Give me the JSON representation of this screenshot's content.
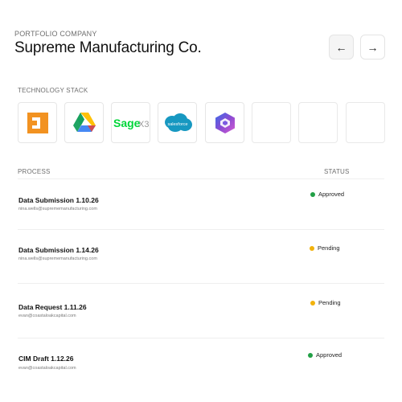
{
  "header": {
    "eyebrow": "PORTFOLIO COMPANY",
    "title": "Supreme Manufacturing Co.",
    "prev_icon": "arrow-left-icon",
    "next_icon": "arrow-right-icon",
    "prev_glyph": "←",
    "next_glyph": "→"
  },
  "stack": {
    "label": "TECHNOLOGY STACK",
    "tiles": [
      {
        "name": "orange-square-logo",
        "color": "#f29221"
      },
      {
        "name": "google-drive-logo",
        "colors": [
          "#1fa463",
          "#ffd04b",
          "#4688f4"
        ]
      },
      {
        "name": "sage-x3-logo",
        "text": "Sage",
        "suffix": "X3",
        "color": "#00d639"
      },
      {
        "name": "salesforce-logo",
        "text": "salesforce",
        "color": "#1798c1"
      },
      {
        "name": "microsoft-copilot-logo",
        "colors": [
          "#3b6de8",
          "#8a4bd3",
          "#d65bd0"
        ]
      },
      {
        "name": "empty-slot"
      },
      {
        "name": "empty-slot"
      },
      {
        "name": "empty-slot"
      }
    ]
  },
  "table": {
    "process_header": "PROCESS",
    "status_header": "STATUS",
    "rows": [
      {
        "title": "Data Submission 1.10.26",
        "email": "nina.wells@suprememanufacturing.com",
        "status": "Approved",
        "status_color": "#22a046"
      },
      {
        "title": "Data Submission 1.14.26",
        "email": "nina.wells@suprememanufacturing.com",
        "status": "Pending",
        "status_color": "#f2b20c"
      },
      {
        "title": "Data Request 1.11.26",
        "email": "evan@coastaloakcapital.com",
        "status": "Pending",
        "status_color": "#f2b20c"
      },
      {
        "title": "CIM Draft 1.12.26",
        "email": "evan@coastaloakcapital.com",
        "status": "Approved",
        "status_color": "#22a046"
      }
    ]
  }
}
